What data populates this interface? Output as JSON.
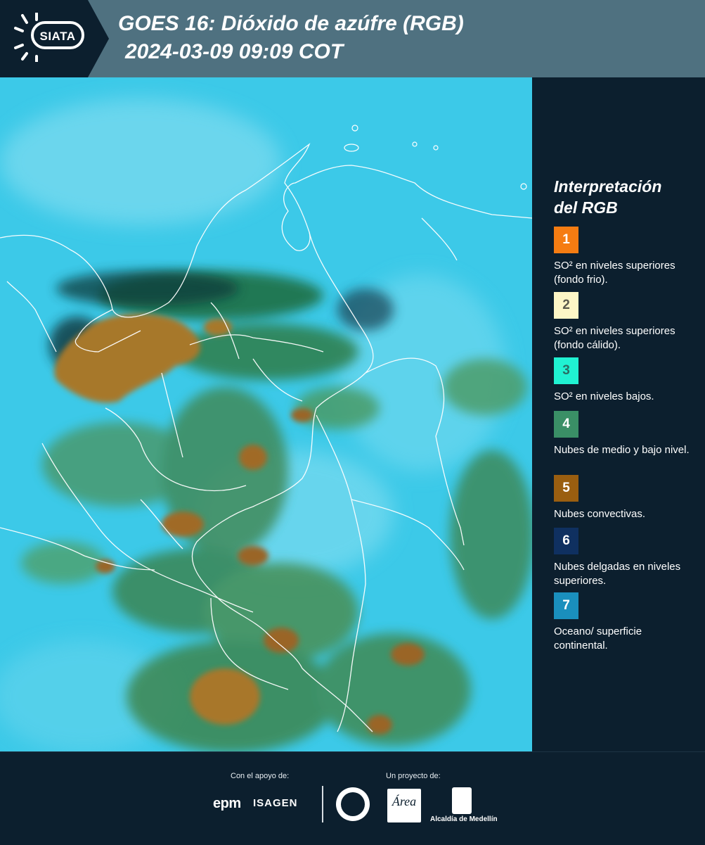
{
  "header": {
    "logo_text": "SIATA",
    "title_line1": "GOES 16: Dióxido de azúfre (RGB)",
    "title_line2": "2024-03-09 09:09 COT"
  },
  "legend": {
    "title_line1": "Interpretación",
    "title_line2": "del RGB",
    "items": [
      {
        "number": "1",
        "color": "#f57c12",
        "label": "SO² en niveles superiores (fondo frio)."
      },
      {
        "number": "2",
        "color": "#fdf6c6",
        "label": "SO² en niveles superiores (fondo cálido)."
      },
      {
        "number": "3",
        "color": "#20f2d2",
        "label": "SO² en niveles bajos."
      },
      {
        "number": "4",
        "color": "#3a8f66",
        "label": "Nubes de medio y bajo nivel."
      },
      {
        "number": "5",
        "color": "#9a5e10",
        "label": "Nubes convectivas."
      },
      {
        "number": "6",
        "color": "#0f3060",
        "label": "Nubes delgadas en niveles superiores."
      },
      {
        "number": "7",
        "color": "#1a8fbd",
        "label": "Oceano/ superficie continental."
      }
    ]
  },
  "footer": {
    "support_label": "Con el apoyo de:",
    "project_label": "Un proyecto de:",
    "epm": "epm",
    "isagen": "ISAGEN",
    "area_logo": "Área",
    "alcaldia": "Alcaldía de Medellín"
  },
  "colors": {
    "background": "#0c1f2e",
    "header": "#4f7180",
    "sky": "#3cc9e8"
  }
}
